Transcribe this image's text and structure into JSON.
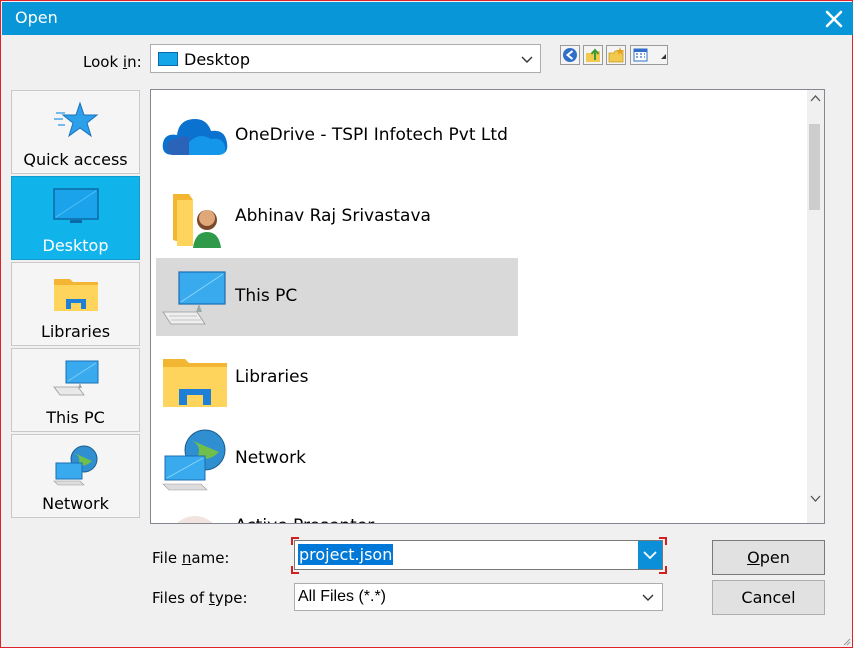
{
  "window": {
    "title": "Open"
  },
  "lookin": {
    "label_pre": "Look ",
    "label_accel": "i",
    "label_post": "n:",
    "value": "Desktop"
  },
  "places": [
    {
      "label": "Quick access",
      "icon": "star-icon",
      "active": false
    },
    {
      "label": "Desktop",
      "icon": "desktop-icon",
      "active": true
    },
    {
      "label": "Libraries",
      "icon": "libraries-icon",
      "active": false
    },
    {
      "label": "This PC",
      "icon": "computer-icon",
      "active": false
    },
    {
      "label": "Network",
      "icon": "network-icon",
      "active": false
    }
  ],
  "files": [
    {
      "name": "OneDrive - TSPI Infotech Pvt Ltd",
      "icon": "cloud-icon",
      "selected": false
    },
    {
      "name": "Abhinav Raj Srivastava",
      "icon": "user-folder-icon",
      "selected": false
    },
    {
      "name": "This PC",
      "icon": "computer-icon",
      "selected": true
    },
    {
      "name": "Libraries",
      "icon": "libraries-icon",
      "selected": false
    },
    {
      "name": "Network",
      "icon": "network-icon",
      "selected": false
    },
    {
      "name": "Active Presenter",
      "icon": "app-icon",
      "selected": false
    }
  ],
  "filename": {
    "label_pre": "File ",
    "label_accel": "n",
    "label_post": "ame:",
    "value": "project.json"
  },
  "filetype": {
    "label_pre": "Files of ",
    "label_accel": "t",
    "label_post": "ype:",
    "value": "All Files (*.*)"
  },
  "buttons": {
    "open_accel": "O",
    "open_rest": "pen",
    "cancel": "Cancel"
  },
  "colors": {
    "titlebar": "#0896d8",
    "accent": "#10b4ea",
    "selection": "#0078d7",
    "highlight": "#d9d9d9"
  }
}
